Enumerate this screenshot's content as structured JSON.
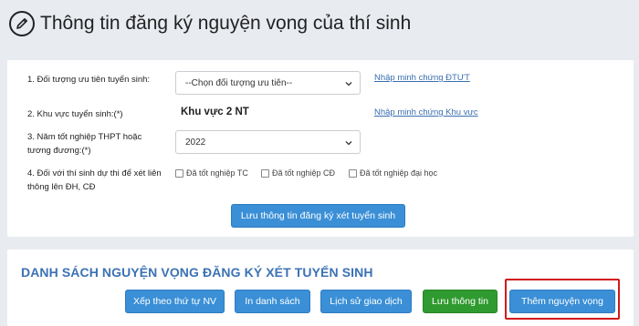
{
  "header": {
    "title": "Thông tin đăng ký nguyện vọng của thí sinh"
  },
  "form": {
    "f1": {
      "label": "1. Đối tượng ưu tiên tuyển sinh:",
      "select_value": "--Chọn đối tượng ưu tiên--",
      "link": "Nhập minh chứng ĐTƯT"
    },
    "f2": {
      "label": "2. Khu vực tuyển sinh:(*)",
      "value": "Khu vực 2 NT",
      "link": "Nhập minh chứng Khu vực"
    },
    "f3": {
      "label": "3. Năm tốt nghiệp THPT hoặc tương đương:(*)",
      "select_value": "2022"
    },
    "f4": {
      "label": "4. Đối với thí sinh dự thi để xét liên thông lên ĐH, CĐ",
      "options": [
        "Đã tốt nghiệp TC",
        "Đã tốt nghiệp CĐ",
        "Đã tốt nghiệp đại học"
      ]
    },
    "save_button": "Lưu thông tin đăng ký xét tuyển sinh"
  },
  "list": {
    "title": "DANH SÁCH NGUYỆN VỌNG ĐĂNG KÝ XÉT TUYỂN SINH",
    "buttons": {
      "sort": "Xếp theo thứ tự NV",
      "print": "In danh sách",
      "history": "Lịch sử giao dịch",
      "save": "Lưu thông tin",
      "add": "Thêm nguyện vọng"
    }
  },
  "colors": {
    "accent": "#3a8fd6",
    "green": "#2f9a2f",
    "highlight": "#d11a1a",
    "title_blue": "#3b72b4"
  }
}
